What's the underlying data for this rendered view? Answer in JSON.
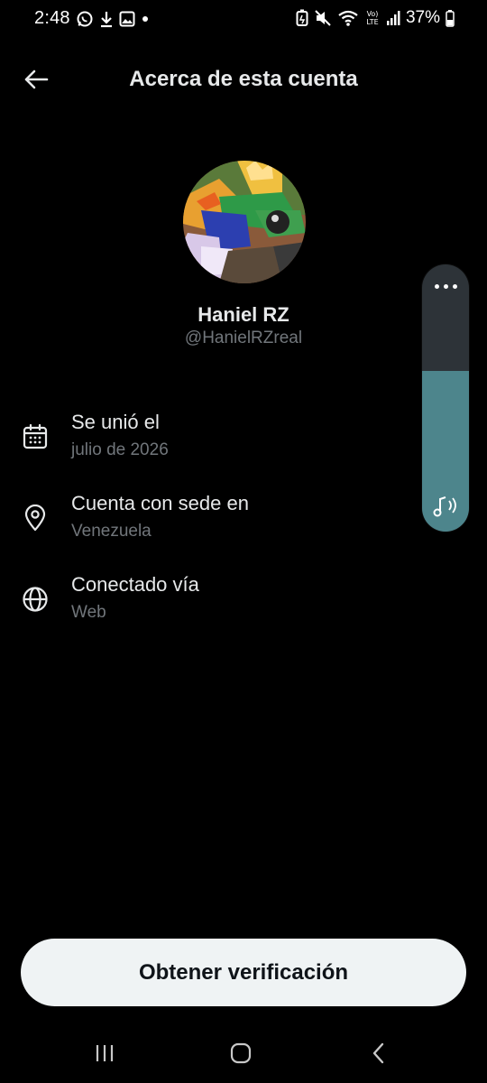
{
  "status_bar": {
    "time": "2:48",
    "battery_percent": "37%",
    "network_label": "Vo) LTE",
    "left_icons": [
      "whatsapp-icon",
      "download-icon",
      "gallery-icon",
      "dot-icon"
    ],
    "right_icons": [
      "battery-saver-icon",
      "mute-icon",
      "wifi-icon",
      "volte-icon",
      "signal-icon",
      "battery-icon"
    ]
  },
  "header": {
    "title": "Acerca de esta cuenta",
    "back_icon": "arrow-left-icon"
  },
  "profile": {
    "name": "Haniel RZ",
    "handle": "@HanielRZreal"
  },
  "details": [
    {
      "icon": "calendar-icon",
      "label": "Se unió el",
      "value": "julio de 2026"
    },
    {
      "icon": "location-pin-icon",
      "label": "Cuenta con sede en",
      "value": "Venezuela"
    },
    {
      "icon": "globe-icon",
      "label": "Conectado vía",
      "value": "Web"
    }
  ],
  "volume_overlay": {
    "level_fraction": 0.6,
    "more_icon": "more-dots-icon",
    "stream_icon": "music-note-icon"
  },
  "actions": {
    "verify_label": "Obtener verificación"
  },
  "nav_bar": {
    "items": [
      "recents-icon",
      "home-icon",
      "back-icon"
    ]
  },
  "colors": {
    "background": "#000000",
    "primary_text": "#e7e9ea",
    "secondary_text": "#71767b",
    "button_bg": "#eff3f4",
    "button_text": "#0f1419",
    "volume_fill": "#4d858c"
  }
}
